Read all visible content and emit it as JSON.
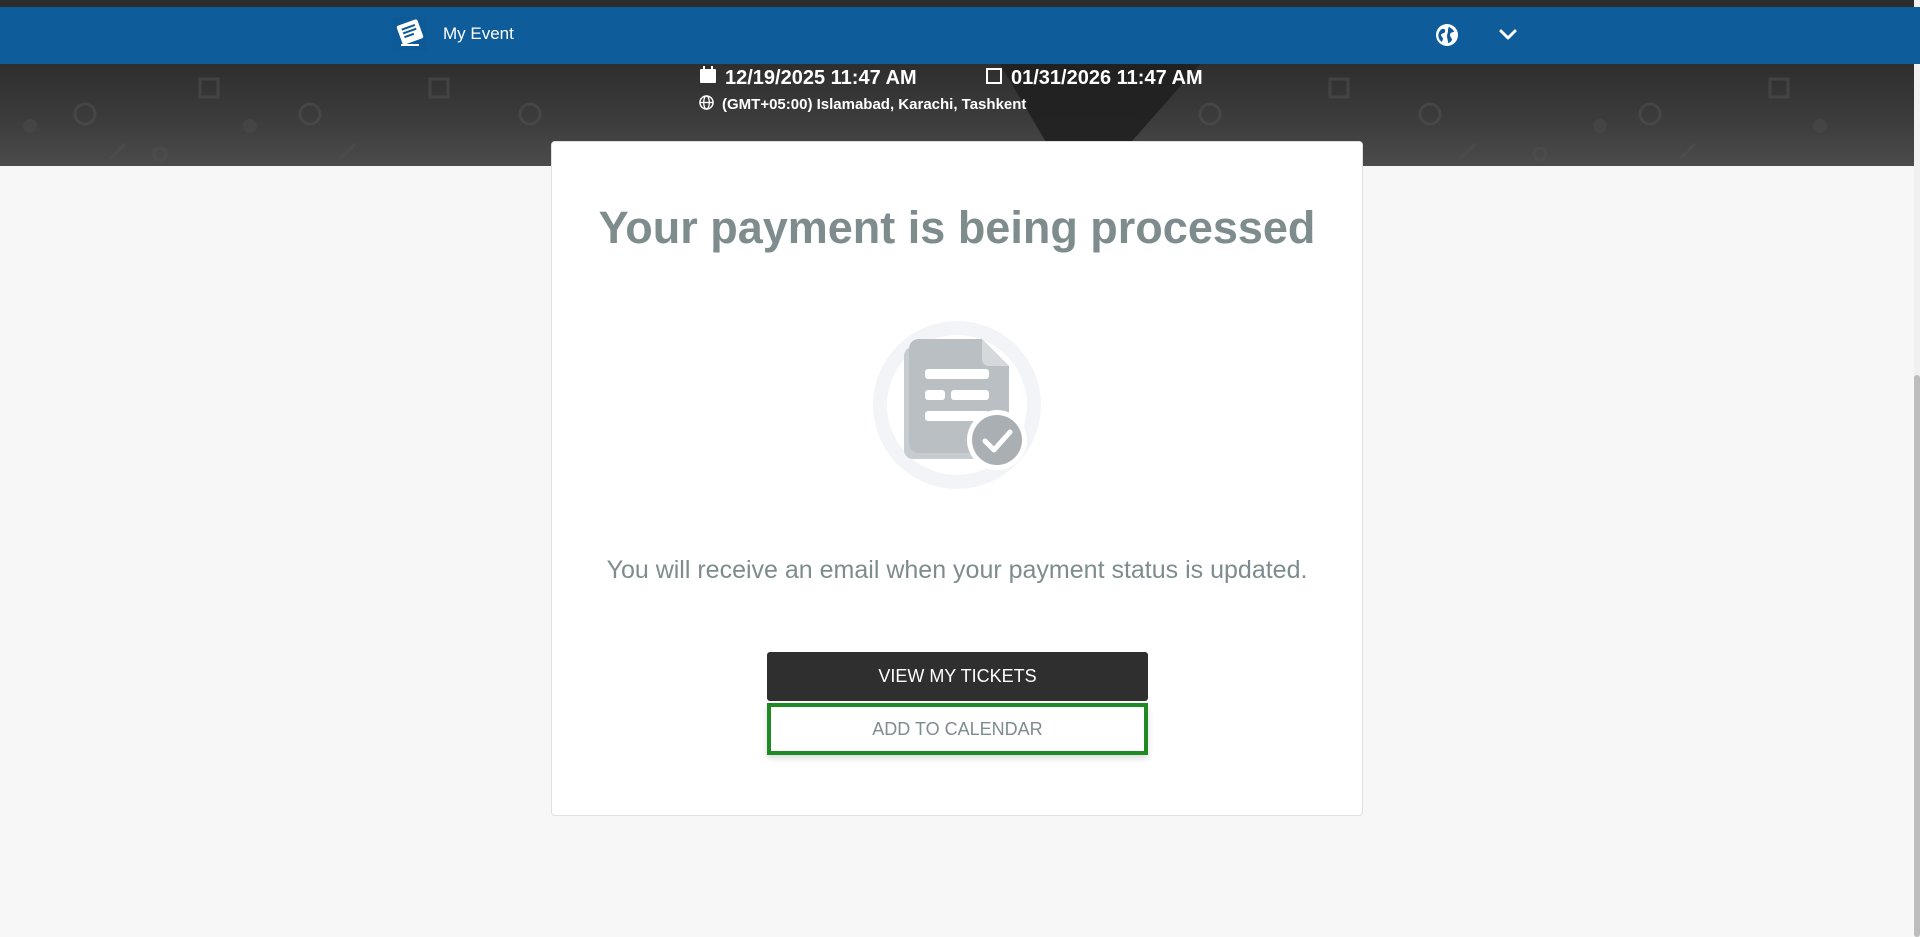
{
  "navbar": {
    "app_name": "My Event",
    "logo_icon": "event-logo-icon",
    "globe_icon": "globe-icon",
    "menu_icon": "chevron-down-icon",
    "color": "#0f5c9a"
  },
  "event": {
    "start_datetime": "12/19/2025 11:47 AM",
    "end_datetime": "01/31/2026 11:47 AM",
    "timezone": "(GMT+05:00) Islamabad, Karachi, Tashkent"
  },
  "confirmation": {
    "title": "Your payment is being processed",
    "illustration_icon": "document-check-icon",
    "message": "You will receive an email when your payment status is updated.",
    "view_tickets_label": "VIEW MY TICKETS",
    "add_calendar_label": "ADD TO CALENDAR"
  },
  "colors": {
    "text_muted": "#7e8c8d",
    "focus_outline": "#1f8a24",
    "primary_button": "#2f2f2f"
  }
}
